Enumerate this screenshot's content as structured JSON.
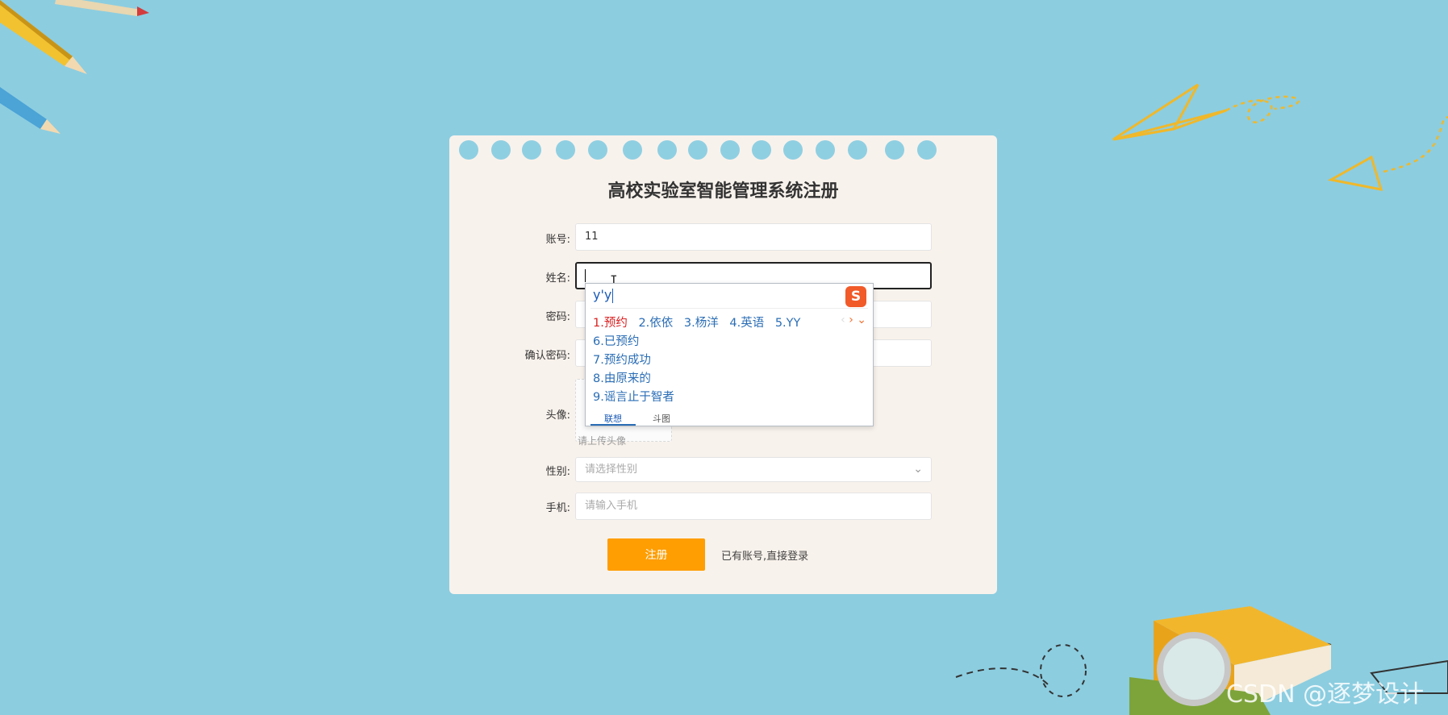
{
  "form": {
    "title": "高校实验室智能管理系统注册",
    "account": {
      "label": "账号:",
      "value": "11"
    },
    "name": {
      "label": "姓名:",
      "value": ""
    },
    "password": {
      "label": "密码:"
    },
    "confirm_password": {
      "label": "确认密码:"
    },
    "avatar": {
      "label": "头像:",
      "hint": "请上传头像"
    },
    "gender": {
      "label": "性别:",
      "placeholder": "请选择性别"
    },
    "phone": {
      "label": "手机:",
      "placeholder": "请输入手机"
    },
    "register_button": "注册",
    "login_link": "已有账号,直接登录"
  },
  "ime": {
    "composition": "y'y",
    "logo": "S",
    "first_row": [
      "1.预约",
      "2.依依",
      "3.杨洋",
      "4.英语",
      "5.YY"
    ],
    "candidates": [
      "6.已预约",
      "7.预约成功",
      "8.由原来的",
      "9.谣言止于智者"
    ],
    "tabs": [
      "联想",
      "斗图"
    ],
    "prev_icon": "‹",
    "next_icon": "›",
    "expand_icon": "⌄"
  },
  "watermark": "CSDN @逐梦设计",
  "colors": {
    "background": "#8ccde0",
    "card": "#f8f2ec",
    "accent": "#ff9e02"
  }
}
